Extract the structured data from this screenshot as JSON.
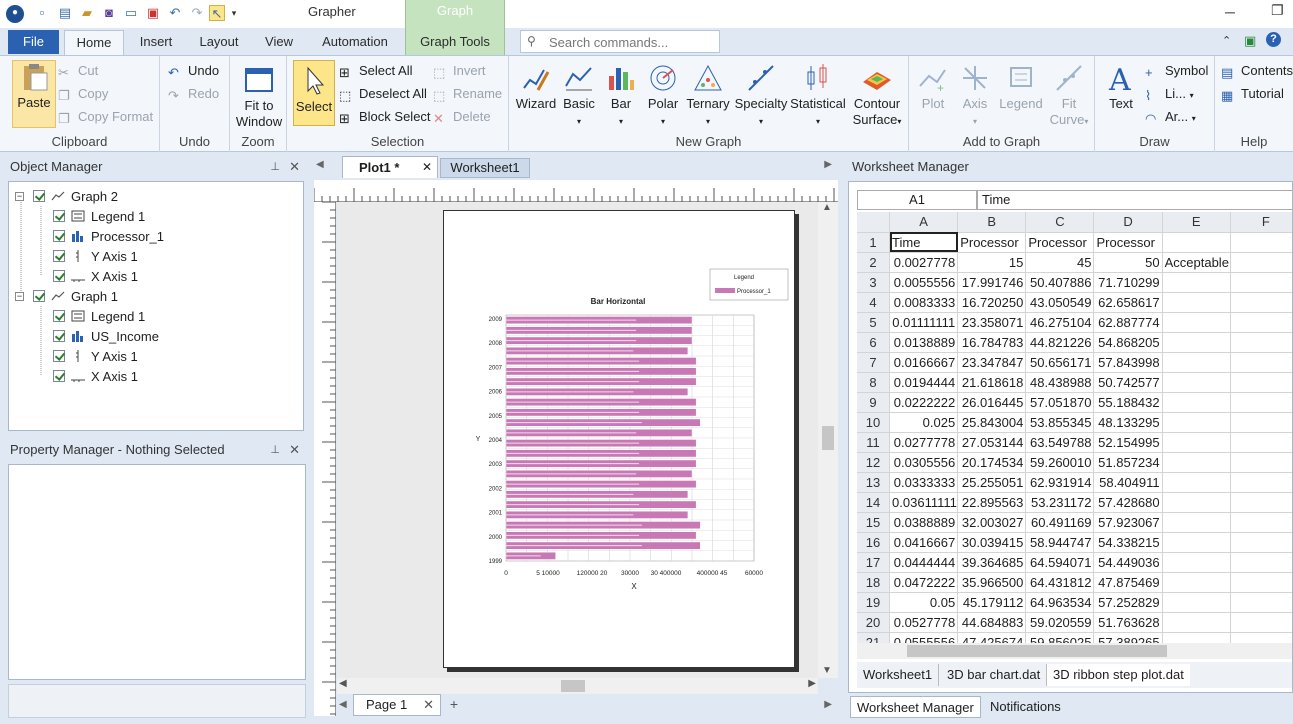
{
  "app": {
    "title": "Grapher",
    "context_tab_group": "Graph",
    "search_placeholder": "Search commands..."
  },
  "menu_tabs": [
    "File",
    "Home",
    "Insert",
    "Layout",
    "View",
    "Automation",
    "Graph Tools"
  ],
  "ribbon": {
    "clipboard": {
      "paste": "Paste",
      "cut": "Cut",
      "copy": "Copy",
      "copy_format": "Copy Format",
      "label": "Clipboard"
    },
    "undo": {
      "undo": "Undo",
      "redo": "Redo",
      "label": "Undo"
    },
    "zoom": {
      "fit": "Fit to Window",
      "label": "Zoom"
    },
    "selection": {
      "select": "Select",
      "select_all": "Select All",
      "deselect_all": "Deselect All",
      "block_select": "Block Select",
      "invert": "Invert",
      "rename": "Rename",
      "delete": "Delete",
      "label": "Selection"
    },
    "new_graph": {
      "items": [
        "Wizard",
        "Basic",
        "Bar",
        "Polar",
        "Ternary",
        "Specialty",
        "Statistical",
        "Contour Surface"
      ],
      "label": "New Graph"
    },
    "add_to_graph": {
      "items": [
        "Plot",
        "Axis",
        "Legend",
        "Fit Curve"
      ],
      "label": "Add to Graph"
    },
    "draw": {
      "text": "Text",
      "symbol": "Symbol",
      "line": "Li...",
      "arc": "Ar...",
      "label": "Draw"
    },
    "help": {
      "contents": "Contents",
      "tutorial": "Tutorial",
      "label": "Help"
    }
  },
  "object_manager": {
    "title": "Object Manager",
    "tree": [
      {
        "label": "Graph 2",
        "level": 0,
        "icon": "graph-icon"
      },
      {
        "label": "Legend 1",
        "level": 1,
        "icon": "legend-icon"
      },
      {
        "label": "Processor_1",
        "level": 1,
        "icon": "bar-plot-icon"
      },
      {
        "label": "Y Axis 1",
        "level": 1,
        "icon": "y-axis-icon"
      },
      {
        "label": "X Axis 1",
        "level": 1,
        "icon": "x-axis-icon"
      },
      {
        "label": "Graph 1",
        "level": 0,
        "icon": "graph-icon"
      },
      {
        "label": "Legend 1",
        "level": 1,
        "icon": "legend-icon"
      },
      {
        "label": "US_Income",
        "level": 1,
        "icon": "bar-plot-icon"
      },
      {
        "label": "Y Axis 1",
        "level": 1,
        "icon": "y-axis-icon"
      },
      {
        "label": "X Axis 1",
        "level": 1,
        "icon": "x-axis-icon"
      }
    ]
  },
  "property_manager": {
    "title": "Property Manager - Nothing Selected"
  },
  "doc_tabs": [
    "Plot1 *",
    "Worksheet1"
  ],
  "page_tab": "Page 1",
  "plot": {
    "title": "Bar Horizontal",
    "legend_title": "Legend",
    "legend_entry": "Processor_1",
    "xlabel": "X",
    "ylabel": "Y",
    "yticks": [
      "2009",
      "2008",
      "2007",
      "2006",
      "2005",
      "2004",
      "2003",
      "2002",
      "2001",
      "2000",
      "1999"
    ],
    "xticks": [
      "0",
      "5 10000",
      "120000 20",
      "30000",
      "30 400000",
      "400000 45",
      "60000"
    ],
    "bar_color": "#c878b4"
  },
  "chart_data": {
    "type": "bar",
    "title": "Bar Horizontal",
    "xlabel": "X",
    "ylabel": "Y",
    "series": [
      {
        "name": "Processor_1",
        "values": [
          45,
          45,
          45,
          44,
          46,
          46,
          46,
          44,
          46,
          46,
          47,
          45,
          46,
          46,
          46,
          45,
          46,
          44,
          46,
          44,
          47,
          46,
          47,
          12
        ]
      }
    ]
  },
  "worksheet_manager": {
    "title": "Worksheet Manager",
    "cell_ref": "A1",
    "cell_value": "Time",
    "columns": [
      "A",
      "B",
      "C",
      "D",
      "E",
      "F"
    ],
    "rows": [
      [
        "1",
        "Time",
        "Processor",
        "Processor",
        "Processor",
        "",
        ""
      ],
      [
        "2",
        "0.0027778",
        "15",
        "45",
        "50",
        "Acceptable",
        ""
      ],
      [
        "3",
        "0.0055556",
        "17.991746",
        "50.407886",
        "71.710299",
        "",
        ""
      ],
      [
        "4",
        "0.0083333",
        "16.720250",
        "43.050549",
        "62.658617",
        "",
        ""
      ],
      [
        "5",
        "0.01111111",
        "23.358071",
        "46.275104",
        "62.887774",
        "",
        ""
      ],
      [
        "6",
        "0.0138889",
        "16.784783",
        "44.821226",
        "54.868205",
        "",
        ""
      ],
      [
        "7",
        "0.0166667",
        "23.347847",
        "50.656171",
        "57.843998",
        "",
        ""
      ],
      [
        "8",
        "0.0194444",
        "21.618618",
        "48.438988",
        "50.742577",
        "",
        ""
      ],
      [
        "9",
        "0.0222222",
        "26.016445",
        "57.051870",
        "55.188432",
        "",
        ""
      ],
      [
        "10",
        "0.025",
        "25.843004",
        "53.855345",
        "48.133295",
        "",
        ""
      ],
      [
        "11",
        "0.0277778",
        "27.053144",
        "63.549788",
        "52.154995",
        "",
        ""
      ],
      [
        "12",
        "0.0305556",
        "20.174534",
        "59.260010",
        "51.857234",
        "",
        ""
      ],
      [
        "13",
        "0.0333333",
        "25.255051",
        "62.931914",
        "58.404911",
        "",
        ""
      ],
      [
        "14",
        "0.03611111",
        "22.895563",
        "53.231172",
        "57.428680",
        "",
        ""
      ],
      [
        "15",
        "0.0388889",
        "32.003027",
        "60.491169",
        "57.923067",
        "",
        ""
      ],
      [
        "16",
        "0.0416667",
        "30.039415",
        "58.944747",
        "54.338215",
        "",
        ""
      ],
      [
        "17",
        "0.0444444",
        "39.364685",
        "64.594071",
        "54.449036",
        "",
        ""
      ],
      [
        "18",
        "0.0472222",
        "35.966500",
        "64.431812",
        "47.875469",
        "",
        ""
      ],
      [
        "19",
        "0.05",
        "45.179112",
        "64.963534",
        "57.252829",
        "",
        ""
      ],
      [
        "20",
        "0.0527778",
        "44.684883",
        "59.020559",
        "51.763628",
        "",
        ""
      ],
      [
        "21",
        "0.0555556",
        "47.425674",
        "59.856025",
        "57.389265",
        "",
        ""
      ]
    ],
    "sheet_tabs": [
      "Worksheet1",
      "3D bar chart.dat",
      "3D ribbon step plot.dat"
    ]
  },
  "bottom_tabs": [
    "Worksheet Manager",
    "Notifications"
  ]
}
